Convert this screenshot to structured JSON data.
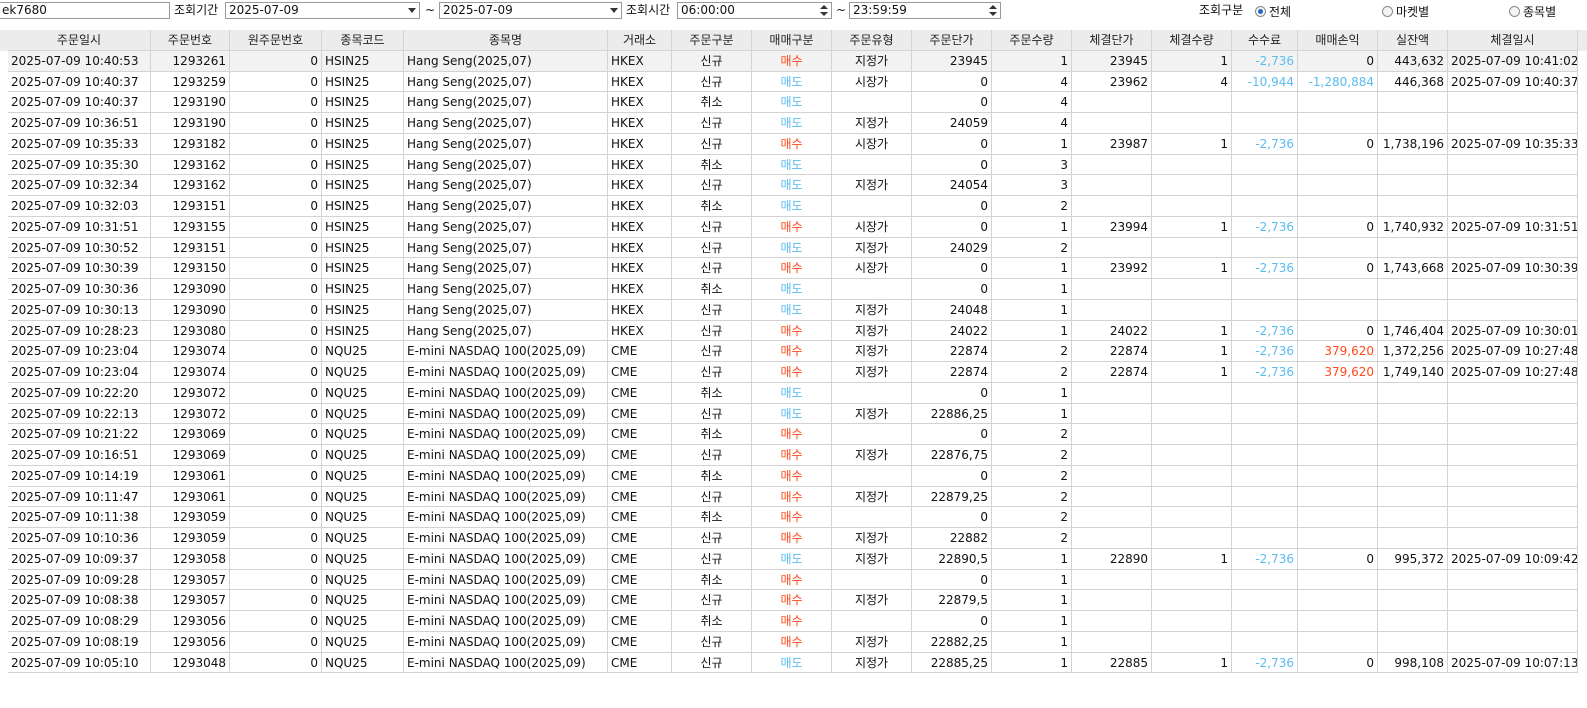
{
  "toolbar": {
    "account": "ek7680",
    "period_label": "조회기간",
    "date_from": "2025-07-09",
    "tilde": "~",
    "date_to": "2025-07-09",
    "time_label": "조회시간",
    "time_from": "06:00:00",
    "time_to": "23:59:59",
    "mode_label": "조회구분",
    "mode_all": "전체",
    "mode_market": "마켓별",
    "mode_item": "종목별"
  },
  "table": {
    "columns": [
      "주문일시",
      "주문번호",
      "원주문번호",
      "종목코드",
      "종목명",
      "거래소",
      "주문구분",
      "매매구분",
      "주문유형",
      "주문단가",
      "주문수량",
      "체결단가",
      "체결수량",
      "수수료",
      "매매손익",
      "실잔액",
      "체결일시"
    ],
    "rows": [
      [
        "2025-07-09 10:40:53",
        "1293261",
        "0",
        "HSIN25",
        "Hang Seng(2025,07)",
        "HKEX",
        "신규",
        "매수",
        "지정가",
        "23945",
        "1",
        "23945",
        "1",
        "-2,736",
        "0",
        "443,632",
        "2025-07-09 10:41:02"
      ],
      [
        "2025-07-09 10:40:37",
        "1293259",
        "0",
        "HSIN25",
        "Hang Seng(2025,07)",
        "HKEX",
        "신규",
        "매도",
        "시장가",
        "0",
        "4",
        "23962",
        "4",
        "-10,944",
        "-1,280,884",
        "446,368",
        "2025-07-09 10:40:37"
      ],
      [
        "2025-07-09 10:40:37",
        "1293190",
        "0",
        "HSIN25",
        "Hang Seng(2025,07)",
        "HKEX",
        "취소",
        "매도",
        "",
        "0",
        "4",
        "",
        "",
        "",
        "",
        "",
        ""
      ],
      [
        "2025-07-09 10:36:51",
        "1293190",
        "0",
        "HSIN25",
        "Hang Seng(2025,07)",
        "HKEX",
        "신규",
        "매도",
        "지정가",
        "24059",
        "4",
        "",
        "",
        "",
        "",
        "",
        ""
      ],
      [
        "2025-07-09 10:35:33",
        "1293182",
        "0",
        "HSIN25",
        "Hang Seng(2025,07)",
        "HKEX",
        "신규",
        "매수",
        "시장가",
        "0",
        "1",
        "23987",
        "1",
        "-2,736",
        "0",
        "1,738,196",
        "2025-07-09 10:35:33"
      ],
      [
        "2025-07-09 10:35:30",
        "1293162",
        "0",
        "HSIN25",
        "Hang Seng(2025,07)",
        "HKEX",
        "취소",
        "매도",
        "",
        "0",
        "3",
        "",
        "",
        "",
        "",
        "",
        ""
      ],
      [
        "2025-07-09 10:32:34",
        "1293162",
        "0",
        "HSIN25",
        "Hang Seng(2025,07)",
        "HKEX",
        "신규",
        "매도",
        "지정가",
        "24054",
        "3",
        "",
        "",
        "",
        "",
        "",
        ""
      ],
      [
        "2025-07-09 10:32:03",
        "1293151",
        "0",
        "HSIN25",
        "Hang Seng(2025,07)",
        "HKEX",
        "취소",
        "매도",
        "",
        "0",
        "2",
        "",
        "",
        "",
        "",
        "",
        ""
      ],
      [
        "2025-07-09 10:31:51",
        "1293155",
        "0",
        "HSIN25",
        "Hang Seng(2025,07)",
        "HKEX",
        "신규",
        "매수",
        "시장가",
        "0",
        "1",
        "23994",
        "1",
        "-2,736",
        "0",
        "1,740,932",
        "2025-07-09 10:31:51"
      ],
      [
        "2025-07-09 10:30:52",
        "1293151",
        "0",
        "HSIN25",
        "Hang Seng(2025,07)",
        "HKEX",
        "신규",
        "매도",
        "지정가",
        "24029",
        "2",
        "",
        "",
        "",
        "",
        "",
        ""
      ],
      [
        "2025-07-09 10:30:39",
        "1293150",
        "0",
        "HSIN25",
        "Hang Seng(2025,07)",
        "HKEX",
        "신규",
        "매수",
        "시장가",
        "0",
        "1",
        "23992",
        "1",
        "-2,736",
        "0",
        "1,743,668",
        "2025-07-09 10:30:39"
      ],
      [
        "2025-07-09 10:30:36",
        "1293090",
        "0",
        "HSIN25",
        "Hang Seng(2025,07)",
        "HKEX",
        "취소",
        "매도",
        "",
        "0",
        "1",
        "",
        "",
        "",
        "",
        "",
        ""
      ],
      [
        "2025-07-09 10:30:13",
        "1293090",
        "0",
        "HSIN25",
        "Hang Seng(2025,07)",
        "HKEX",
        "신규",
        "매도",
        "지정가",
        "24048",
        "1",
        "",
        "",
        "",
        "",
        "",
        ""
      ],
      [
        "2025-07-09 10:28:23",
        "1293080",
        "0",
        "HSIN25",
        "Hang Seng(2025,07)",
        "HKEX",
        "신규",
        "매수",
        "지정가",
        "24022",
        "1",
        "24022",
        "1",
        "-2,736",
        "0",
        "1,746,404",
        "2025-07-09 10:30:01"
      ],
      [
        "2025-07-09 10:23:04",
        "1293074",
        "0",
        "NQU25",
        "E-mini NASDAQ 100(2025,09)",
        "CME",
        "신규",
        "매수",
        "지정가",
        "22874",
        "2",
        "22874",
        "1",
        "-2,736",
        "379,620",
        "1,372,256",
        "2025-07-09 10:27:48"
      ],
      [
        "2025-07-09 10:23:04",
        "1293074",
        "0",
        "NQU25",
        "E-mini NASDAQ 100(2025,09)",
        "CME",
        "신규",
        "매수",
        "지정가",
        "22874",
        "2",
        "22874",
        "1",
        "-2,736",
        "379,620",
        "1,749,140",
        "2025-07-09 10:27:48"
      ],
      [
        "2025-07-09 10:22:20",
        "1293072",
        "0",
        "NQU25",
        "E-mini NASDAQ 100(2025,09)",
        "CME",
        "취소",
        "매도",
        "",
        "0",
        "1",
        "",
        "",
        "",
        "",
        "",
        ""
      ],
      [
        "2025-07-09 10:22:13",
        "1293072",
        "0",
        "NQU25",
        "E-mini NASDAQ 100(2025,09)",
        "CME",
        "신규",
        "매도",
        "지정가",
        "22886,25",
        "1",
        "",
        "",
        "",
        "",
        "",
        ""
      ],
      [
        "2025-07-09 10:21:22",
        "1293069",
        "0",
        "NQU25",
        "E-mini NASDAQ 100(2025,09)",
        "CME",
        "취소",
        "매수",
        "",
        "0",
        "2",
        "",
        "",
        "",
        "",
        "",
        ""
      ],
      [
        "2025-07-09 10:16:51",
        "1293069",
        "0",
        "NQU25",
        "E-mini NASDAQ 100(2025,09)",
        "CME",
        "신규",
        "매수",
        "지정가",
        "22876,75",
        "2",
        "",
        "",
        "",
        "",
        "",
        ""
      ],
      [
        "2025-07-09 10:14:19",
        "1293061",
        "0",
        "NQU25",
        "E-mini NASDAQ 100(2025,09)",
        "CME",
        "취소",
        "매수",
        "",
        "0",
        "2",
        "",
        "",
        "",
        "",
        "",
        ""
      ],
      [
        "2025-07-09 10:11:47",
        "1293061",
        "0",
        "NQU25",
        "E-mini NASDAQ 100(2025,09)",
        "CME",
        "신규",
        "매수",
        "지정가",
        "22879,25",
        "2",
        "",
        "",
        "",
        "",
        "",
        ""
      ],
      [
        "2025-07-09 10:11:38",
        "1293059",
        "0",
        "NQU25",
        "E-mini NASDAQ 100(2025,09)",
        "CME",
        "취소",
        "매수",
        "",
        "0",
        "2",
        "",
        "",
        "",
        "",
        "",
        ""
      ],
      [
        "2025-07-09 10:10:36",
        "1293059",
        "0",
        "NQU25",
        "E-mini NASDAQ 100(2025,09)",
        "CME",
        "신규",
        "매수",
        "지정가",
        "22882",
        "2",
        "",
        "",
        "",
        "",
        "",
        ""
      ],
      [
        "2025-07-09 10:09:37",
        "1293058",
        "0",
        "NQU25",
        "E-mini NASDAQ 100(2025,09)",
        "CME",
        "신규",
        "매도",
        "지정가",
        "22890,5",
        "1",
        "22890",
        "1",
        "-2,736",
        "0",
        "995,372",
        "2025-07-09 10:09:42"
      ],
      [
        "2025-07-09 10:09:28",
        "1293057",
        "0",
        "NQU25",
        "E-mini NASDAQ 100(2025,09)",
        "CME",
        "취소",
        "매수",
        "",
        "0",
        "1",
        "",
        "",
        "",
        "",
        "",
        ""
      ],
      [
        "2025-07-09 10:08:38",
        "1293057",
        "0",
        "NQU25",
        "E-mini NASDAQ 100(2025,09)",
        "CME",
        "신규",
        "매수",
        "지정가",
        "22879,5",
        "1",
        "",
        "",
        "",
        "",
        "",
        ""
      ],
      [
        "2025-07-09 10:08:29",
        "1293056",
        "0",
        "NQU25",
        "E-mini NASDAQ 100(2025,09)",
        "CME",
        "취소",
        "매수",
        "",
        "0",
        "1",
        "",
        "",
        "",
        "",
        "",
        ""
      ],
      [
        "2025-07-09 10:08:19",
        "1293056",
        "0",
        "NQU25",
        "E-mini NASDAQ 100(2025,09)",
        "CME",
        "신규",
        "매수",
        "지정가",
        "22882,25",
        "1",
        "",
        "",
        "",
        "",
        "",
        ""
      ],
      [
        "2025-07-09 10:05:10",
        "1293048",
        "0",
        "NQU25",
        "E-mini NASDAQ 100(2025,09)",
        "CME",
        "신규",
        "매도",
        "지정가",
        "22885,25",
        "1",
        "22885",
        "1",
        "-2,736",
        "0",
        "998,108",
        "2025-07-09 10:07:13"
      ]
    ]
  },
  "colors": {
    "buy": "#ff4a1a",
    "sell": "#5bbcf0",
    "header_bg": "#ececec",
    "selected_row_bg": "#f2f2f2"
  }
}
